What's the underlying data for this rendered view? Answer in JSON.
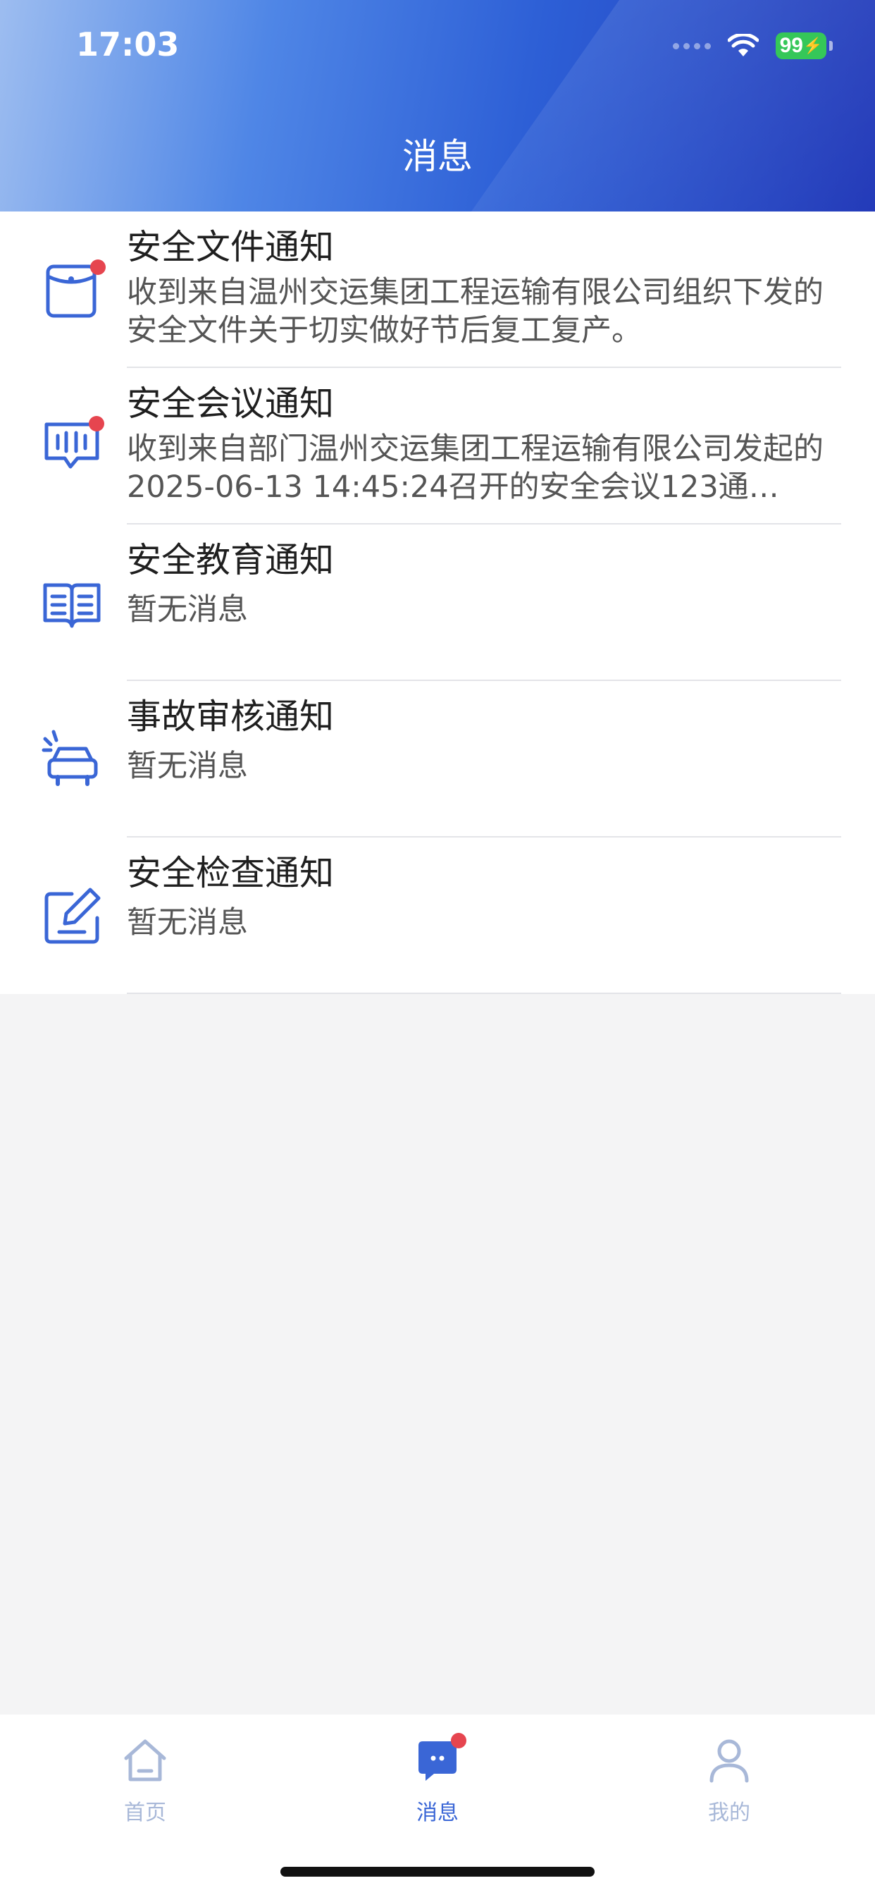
{
  "status_bar": {
    "time": "17:03",
    "battery": "99"
  },
  "header": {
    "title": "消息"
  },
  "notifications": [
    {
      "title": "安全文件通知",
      "description": "收到来自温州交运集团工程运输有限公司组织下发的安全文件关于切实做好节后复工复产。",
      "icon": "document-icon",
      "unread": true
    },
    {
      "title": "安全会议通知",
      "description": "收到来自部门温州交运集团工程运输有限公司发起的2025-06-13 14:45:24召开的安全会议123通…",
      "icon": "meeting-icon",
      "unread": true
    },
    {
      "title": "安全教育通知",
      "description": "暂无消息",
      "icon": "book-icon",
      "unread": false
    },
    {
      "title": "事故审核通知",
      "description": "暂无消息",
      "icon": "car-icon",
      "unread": false
    },
    {
      "title": "安全检查通知",
      "description": "暂无消息",
      "icon": "edit-icon",
      "unread": false
    }
  ],
  "tabbar": {
    "home_label": "首页",
    "messages_label": "消息",
    "mine_label": "我的"
  },
  "colors": {
    "accent": "#3a66d6",
    "badge": "#e6454f",
    "inactive": "#a8b8d8"
  }
}
